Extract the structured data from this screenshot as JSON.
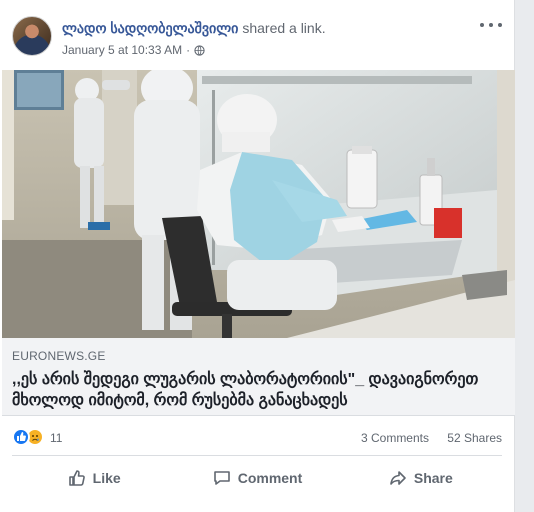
{
  "post": {
    "author": "ლადო სადღობელაშვილი",
    "action_text": "shared a link.",
    "timestamp": "January 5 at 10:33 AM",
    "separator": "·",
    "privacy_icon": "globe-icon",
    "more_icon": "more-options-icon"
  },
  "link": {
    "domain": "EURONEWS.GE",
    "title": ",,ეს არის შედეგი ლუგარის ლაბორატორიის\"_ დავაიგნორეთ მხოლოდ იმიტომ, რომ რუსებმა განაცხადეს"
  },
  "stats": {
    "reactions_count": "11",
    "comments": "3 Comments",
    "shares": "52 Shares",
    "reaction_icons": [
      "like-reaction-icon",
      "sad-reaction-icon"
    ]
  },
  "actions": {
    "like": "Like",
    "comment": "Comment",
    "share": "Share"
  },
  "colors": {
    "author_blue": "#385898",
    "like_blue": "#1877f2",
    "sad_yellow": "#f7b125",
    "secondary_text": "#606770"
  }
}
